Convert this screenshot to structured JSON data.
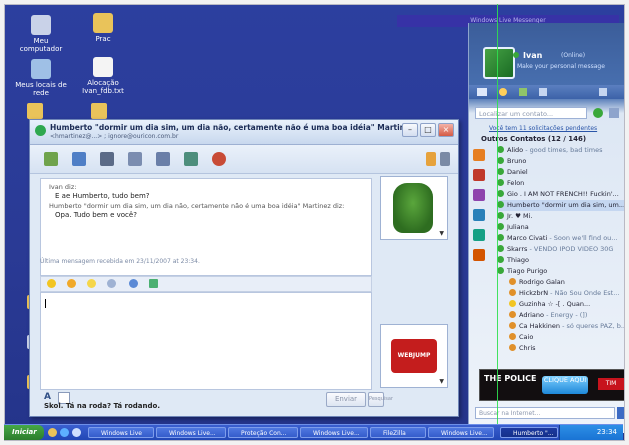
{
  "desktop": {
    "icons": [
      {
        "label": "Meu computador",
        "icon": "computer-icon"
      },
      {
        "label": "Prac",
        "icon": "folder-icon"
      },
      {
        "label": "Meus locais de rede",
        "icon": "network-icon"
      },
      {
        "label": "Alocação Ivan_fdb.txt",
        "icon": "text-file-icon"
      }
    ]
  },
  "chat_window": {
    "title": "Humberto \"dormir um dia sim, um dia não, certamente não é uma boa idéia\" Martinez",
    "subtitle": "<hmartinez@...> ; ignore@ouricon.com.br",
    "conversation": [
      {
        "text": "Ivan diz:",
        "kind": "sender"
      },
      {
        "text": "E ae Humberto, tudo bem?",
        "kind": "message"
      },
      {
        "text": "Humberto \"dormir um dia sim, um dia não, certamente não é uma boa idéia\" Martinez diz:",
        "kind": "sender"
      },
      {
        "text": "Opa. Tudo bem e você?",
        "kind": "message"
      }
    ],
    "last_message": "Última mensagem recebida em 23/11/2007 at 23:34.",
    "send_label": "Enviar",
    "search_label": "Pesquisar",
    "status_text": "Skol. Tá na roda? Tá rodando.",
    "ad_label": "WEBJUMP"
  },
  "messenger": {
    "top_banner": "Windows Live Messenger",
    "user_name": "Ivan",
    "user_status": "(Online)",
    "personal_message": "Make your personal message",
    "search_placeholder": "Localizar um contato...",
    "invites": "Você tem 11 solicitações pendentes",
    "group_label": "Outros Contatos (12 / 146)",
    "contacts": [
      {
        "name": "Alido",
        "psm": " - good times, bad times"
      },
      {
        "name": "Bruno",
        "psm": ""
      },
      {
        "name": "Daniel",
        "psm": ""
      },
      {
        "name": "Felon",
        "psm": ""
      },
      {
        "name": "Gio . I AM NOT FRENCH!! Fuckin'...",
        "psm": ""
      },
      {
        "name": "Humberto \"dormir um dia sim, um...",
        "psm": ""
      },
      {
        "name": "Jr. ♥ Mi.",
        "psm": ""
      },
      {
        "name": "Juliana",
        "psm": ""
      },
      {
        "name": "Marco Civati",
        "psm": " - Soon we'll find ou..."
      },
      {
        "name": "Skarrs",
        "psm": " - VENDO IPOD VIDEO 30G"
      },
      {
        "name": "Thiago",
        "psm": ""
      },
      {
        "name": "Tiago Purigo",
        "psm": ""
      },
      {
        "name": "Rodrigo Galan",
        "psm": ""
      },
      {
        "name": "HickzbrN",
        "psm": " - Não Sou Onde Est..."
      },
      {
        "name": "Guzinha ☆ -[ . Quan...",
        "psm": ""
      },
      {
        "name": "Adriano",
        "psm": " - Energy - (])"
      },
      {
        "name": "Ca Hakkinen",
        "psm": " - só queres PAZ, b..."
      },
      {
        "name": "Caio",
        "psm": ""
      },
      {
        "name": "Chris",
        "psm": ""
      }
    ],
    "ad_police": "THE POLICE",
    "ad_cta": "CLIQUE AQUI",
    "ad_brand": "TIM",
    "web_search": "Buscar na Internet..."
  },
  "taskbar": {
    "start_label": "Iniciar",
    "tasks": [
      {
        "label": "Windows Live",
        "active": false
      },
      {
        "label": "Windows Live...",
        "active": false
      },
      {
        "label": "Proteção Con...",
        "active": false
      },
      {
        "label": "Windows Live...",
        "active": false
      },
      {
        "label": "FileZilla",
        "active": false
      },
      {
        "label": "Windows Live...",
        "active": false
      },
      {
        "label": "Humberto \"...",
        "active": true
      }
    ],
    "clock": "23:34"
  },
  "colors": {
    "desktop": "#2c3f9f",
    "taskbar": "#2147b5",
    "start": "#2b7d2b",
    "online": "#3aa83a"
  }
}
